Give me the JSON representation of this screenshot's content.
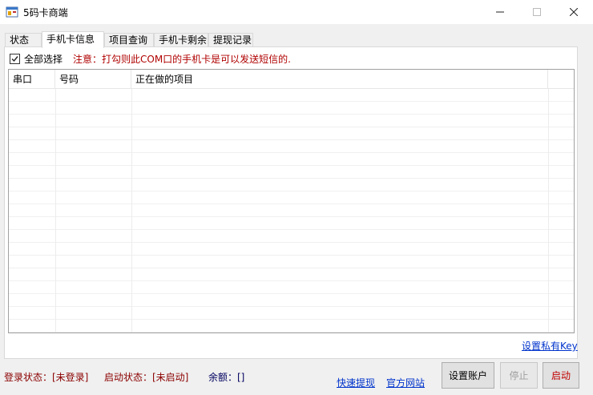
{
  "window": {
    "title": "5码卡商端",
    "icon": "app-window-icon"
  },
  "tabs": [
    {
      "label": "状态",
      "active": false
    },
    {
      "label": "手机卡信息",
      "active": true
    },
    {
      "label": "项目查询",
      "active": false
    },
    {
      "label": "手机卡剩余",
      "active": false
    },
    {
      "label": "提现记录",
      "active": false
    }
  ],
  "panel": {
    "select_all_label": "全部选择",
    "select_all_checked": true,
    "notice": "注意：打勾则此COM口的手机卡是可以发送短信的."
  },
  "grid": {
    "columns": [
      "串口",
      "号码",
      "正在做的项目"
    ],
    "rows": []
  },
  "links": {
    "set_private_key": "设置私有Key",
    "quick_withdraw": "快速提现",
    "official_site": "官方网站"
  },
  "status": {
    "login": "登录状态：[未登录]",
    "start": "启动状态：[未启动]",
    "balance": "余额：[]"
  },
  "buttons": {
    "set_account": "设置账户",
    "stop": "停止",
    "start": "启动"
  },
  "colors": {
    "warning_red": "#b00000",
    "status_red": "#8b0000",
    "link_blue": "#0033cc"
  }
}
